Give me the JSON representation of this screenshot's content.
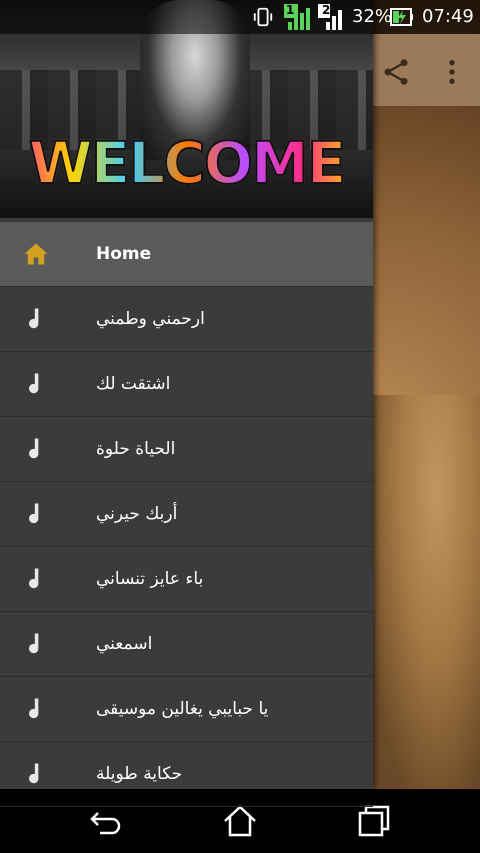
{
  "status_bar": {
    "sim1": "1",
    "sim2": "2",
    "battery": "32%",
    "time": "07:49"
  },
  "header": {
    "banner_text": "WELCOME"
  },
  "menu": {
    "items": [
      {
        "label": "Home",
        "icon": "home-icon",
        "active": true
      },
      {
        "label": "ارحمني وطمني",
        "icon": "music-note-icon"
      },
      {
        "label": "اشتقت لك",
        "icon": "music-note-icon"
      },
      {
        "label": "الحياة حلوة",
        "icon": "music-note-icon"
      },
      {
        "label": "أربك حيرني",
        "icon": "music-note-icon"
      },
      {
        "label": "باء عايز تنساني",
        "icon": "music-note-icon"
      },
      {
        "label": "اسمعني",
        "icon": "music-note-icon"
      },
      {
        "label": "يا حبايبي يغالين موسيقى",
        "icon": "music-note-icon"
      },
      {
        "label": "حكاية طويلة",
        "icon": "music-note-icon"
      }
    ]
  },
  "colors": {
    "home_icon": "#d4a020",
    "drawer_bg": "#3b3b3b",
    "active_bg": "#5a5a5a"
  }
}
